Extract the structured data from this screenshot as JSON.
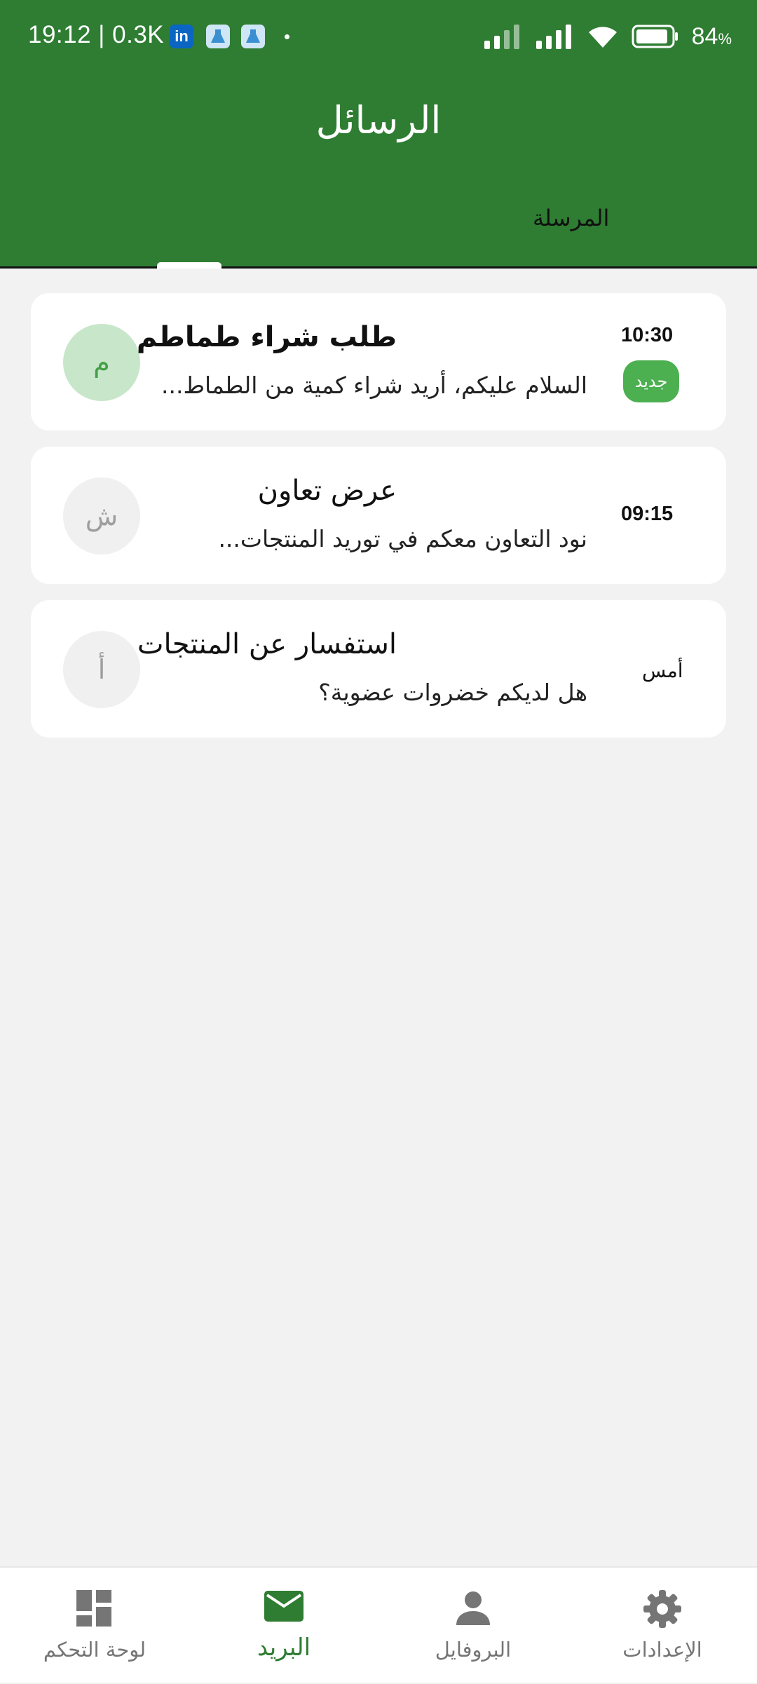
{
  "status_bar": {
    "time_and_speed": "19:12 | 0.3K",
    "linkedin_label": "in",
    "battery_percent": "84",
    "battery_unit": "%"
  },
  "header": {
    "title": "الرسائل",
    "tabs": [
      {
        "label": "المرسلة"
      }
    ]
  },
  "messages": [
    {
      "avatar_letter": "م",
      "subject": "طلب شراء طماطم",
      "preview": "السلام عليكم، أريد شراء كمية من الطماط...",
      "time": "10:30",
      "badge": "جديد",
      "unread": true
    },
    {
      "avatar_letter": "ش",
      "subject": "عرض تعاون",
      "preview": "نود التعاون معكم في توريد المنتجات...",
      "time": "09:15",
      "unread": false
    },
    {
      "avatar_letter": "أ",
      "subject": "استفسار عن المنتجات",
      "preview": "هل لديكم خضروات عضوية؟",
      "time": "أمس",
      "unread": false
    }
  ],
  "bottom_nav": {
    "items": [
      {
        "label": "لوحة التحكم",
        "icon": "dashboard-icon"
      },
      {
        "label": "البريد",
        "icon": "mail-icon",
        "active": true
      },
      {
        "label": "البروفايل",
        "icon": "person-icon"
      },
      {
        "label": "الإعدادات",
        "icon": "gear-icon"
      }
    ]
  },
  "colors": {
    "primary": "#2e7d32",
    "badge": "#4caf50",
    "avatar_highlight": "#c8e6c9"
  }
}
